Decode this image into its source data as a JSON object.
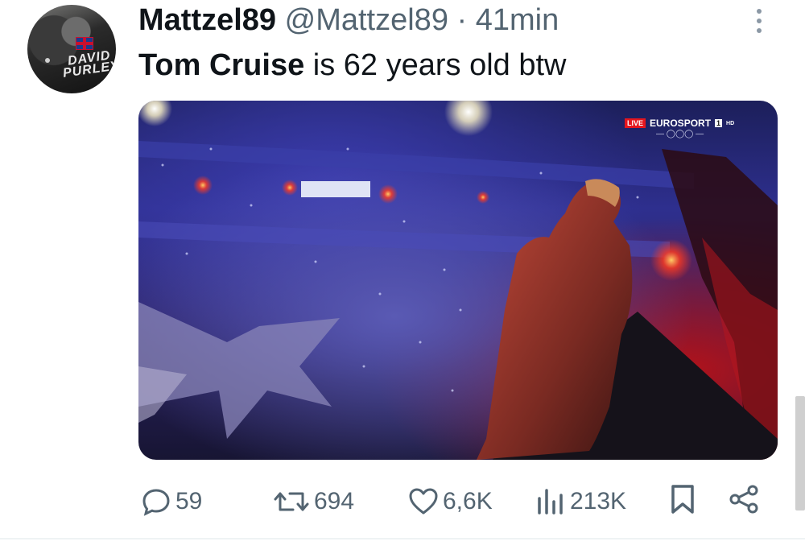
{
  "tweet": {
    "display_name": "Mattzel89",
    "handle": "@Mattzel89",
    "separator": "·",
    "time": "41min",
    "text_bold": "Tom Cruise",
    "text_rest": " is 62 years old btw",
    "avatar_text_1": "DAVID",
    "avatar_text_2": "PURLEY"
  },
  "media": {
    "broadcast_live": "LIVE",
    "broadcast_channel": "EUROSPORT",
    "broadcast_channel_num": "1",
    "broadcast_hd": "HD"
  },
  "actions": {
    "replies": "59",
    "reposts": "694",
    "likes": "6,6K",
    "views": "213K"
  },
  "icons": [
    "more-icon",
    "reply-icon",
    "repost-icon",
    "like-icon",
    "views-icon",
    "bookmark-icon",
    "share-icon"
  ]
}
